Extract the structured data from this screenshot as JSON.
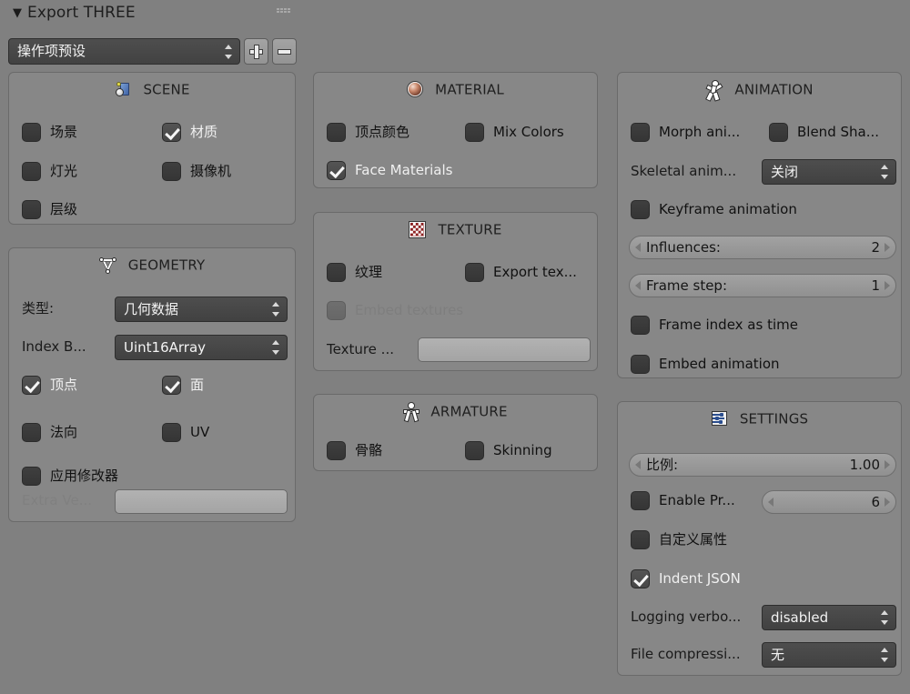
{
  "window": {
    "title": "Export THREE",
    "disclosure_icon": "triangle-down-icon",
    "grip_icon": "drag-grip-icon"
  },
  "preset": {
    "value": "操作项预设",
    "add_label": "+",
    "remove_label": "−"
  },
  "panels": {
    "scene": {
      "title": "SCENE",
      "icon": "scene-icon",
      "checkboxes": [
        {
          "label": "场景",
          "checked": false
        },
        {
          "label": "材质",
          "checked": true
        },
        {
          "label": "灯光",
          "checked": false
        },
        {
          "label": "摄像机",
          "checked": false
        },
        {
          "label": "层级",
          "checked": false
        }
      ]
    },
    "geometry": {
      "title": "GEOMETRY",
      "icon": "geometry-icon",
      "type_label": "类型:",
      "type_value": "几何数据",
      "index_label": "Index B...",
      "index_value": "Uint16Array",
      "checkboxes": [
        {
          "label": "顶点",
          "checked": true
        },
        {
          "label": "面",
          "checked": true
        },
        {
          "label": "法向",
          "checked": false
        },
        {
          "label": "UV",
          "checked": false
        },
        {
          "label": "应用修改器",
          "checked": false
        }
      ],
      "extra_label": "Extra Ve...",
      "extra_value": ""
    },
    "material": {
      "title": "MATERIAL",
      "icon": "material-icon",
      "checkboxes": [
        {
          "label": "顶点颜色",
          "checked": false
        },
        {
          "label": "Mix Colors",
          "checked": false
        },
        {
          "label": "Face Materials",
          "checked": true
        }
      ]
    },
    "texture": {
      "title": "TEXTURE",
      "icon": "texture-icon",
      "checkboxes": [
        {
          "label": "纹理",
          "checked": false,
          "disabled": false
        },
        {
          "label": "Export tex...",
          "checked": false,
          "disabled": false
        },
        {
          "label": "Embed textures",
          "checked": false,
          "disabled": true
        }
      ],
      "path_label": "Texture ...",
      "path_value": ""
    },
    "armature": {
      "title": "ARMATURE",
      "icon": "armature-icon",
      "checkboxes": [
        {
          "label": "骨骼",
          "checked": false
        },
        {
          "label": "Skinning",
          "checked": false
        }
      ]
    },
    "animation": {
      "title": "ANIMATION",
      "icon": "animation-icon",
      "checkboxes": [
        {
          "label": "Morph ani...",
          "checked": false
        },
        {
          "label": "Blend Sha...",
          "checked": false
        },
        {
          "label": "Keyframe animation",
          "checked": false
        },
        {
          "label": "Frame index as time",
          "checked": false
        },
        {
          "label": "Embed animation",
          "checked": false
        }
      ],
      "skeletal_label": "Skeletal anim...",
      "skeletal_value": "关闭",
      "influences_label": "Influences:",
      "influences_value": "2",
      "framestep_label": "Frame step:",
      "framestep_value": "1"
    },
    "settings": {
      "title": "SETTINGS",
      "icon": "settings-icon",
      "scale_label": "比例:",
      "scale_value": "1.00",
      "precision_label": "Enable Pr...",
      "precision_checked": false,
      "precision_value": "6",
      "custom_props_label": "自定义属性",
      "custom_props_checked": false,
      "indent_label": "Indent JSON",
      "indent_checked": true,
      "logging_label": "Logging verbo...",
      "logging_value": "disabled",
      "compression_label": "File compressi...",
      "compression_value": "无"
    }
  },
  "colors": {
    "background": "#808080",
    "panel": "#878787",
    "panel_border": "#6a6a6a",
    "dropdown": "#4a4a4a",
    "slider": "#9a9a9a",
    "text_dark": "#1a1a1a",
    "text_light": "#f2f2f2"
  }
}
